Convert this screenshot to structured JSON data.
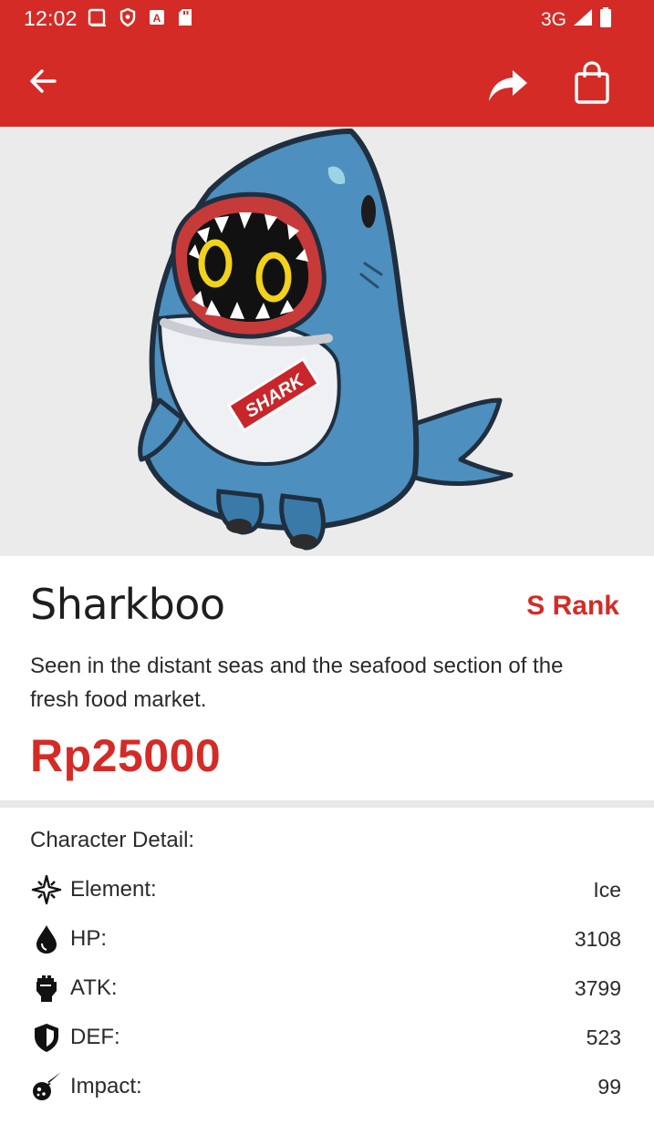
{
  "status_bar": {
    "time": "12:02",
    "network": "3G",
    "icons": [
      "screen-icon",
      "shield-icon",
      "a-badge-icon",
      "sd-card-icon",
      "signal-icon",
      "battery-icon"
    ]
  },
  "app_bar": {
    "icons": [
      "back-arrow-icon",
      "share-icon",
      "shopping-bag-icon"
    ],
    "color": "#d42b26"
  },
  "product": {
    "name": "Sharkboo",
    "rank": "S Rank",
    "description": "Seen in the distant seas and the seafood section of the fresh food market.",
    "price": "Rp25000",
    "image_badge": "SHARK"
  },
  "details": {
    "title": "Character Detail:",
    "rows": [
      {
        "icon": "element-icon",
        "label": "Element:",
        "value": "Ice"
      },
      {
        "icon": "hp-drop-icon",
        "label": "HP:",
        "value": "3108"
      },
      {
        "icon": "atk-fist-icon",
        "label": "ATK:",
        "value": "3799"
      },
      {
        "icon": "def-shield-icon",
        "label": "DEF:",
        "value": "523"
      },
      {
        "icon": "impact-icon",
        "label": "Impact:",
        "value": "99"
      }
    ]
  },
  "colors": {
    "accent": "#d42b26",
    "hero_background": "#ebebeb",
    "divider": "#e8e8e8"
  }
}
